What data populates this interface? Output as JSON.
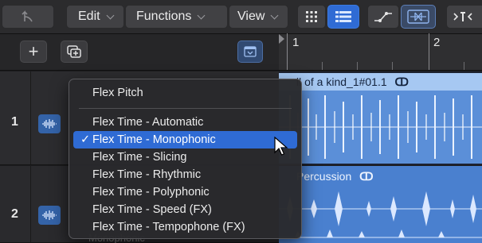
{
  "toolbar": {
    "menus": [
      {
        "label": "Edit"
      },
      {
        "label": "Functions"
      },
      {
        "label": "View"
      }
    ],
    "icons": [
      "catch-playhead-icon",
      "grid-view-icon",
      "list-view-icon",
      "automation-icon",
      "flex-icon",
      "snap-icon"
    ]
  },
  "track_list": {
    "add_button_label": "+",
    "tracks": [
      {
        "number": "1"
      },
      {
        "number": "2"
      }
    ]
  },
  "ruler": {
    "bars": [
      "1",
      "2"
    ]
  },
  "regions": [
    {
      "title": "ll of a kind_1#01.1",
      "loop_symbol": "Ↄ"
    },
    {
      "title": "Percussion",
      "loop_symbol": "Ↄ"
    }
  ],
  "flex_menu": {
    "header_item": "Flex Pitch",
    "items": [
      {
        "label": "Flex Time - Automatic",
        "checked": false
      },
      {
        "label": "Flex Time - Monophonic",
        "checked": true
      },
      {
        "label": "Flex Time - Slicing",
        "checked": false
      },
      {
        "label": "Flex Time - Rhythmic",
        "checked": false
      },
      {
        "label": "Flex Time - Polyphonic",
        "checked": false
      },
      {
        "label": "Flex Time - Speed (FX)",
        "checked": false
      },
      {
        "label": "Flex Time - Tempophone (FX)",
        "checked": false
      }
    ],
    "check_glyph": "✓",
    "underlying_value": "Monophonic"
  },
  "colors": {
    "accent": "#2f6bd4",
    "region_header": "#a6c8f2",
    "region_body": "#5b8fd8",
    "track_icon": "#3463a8"
  }
}
